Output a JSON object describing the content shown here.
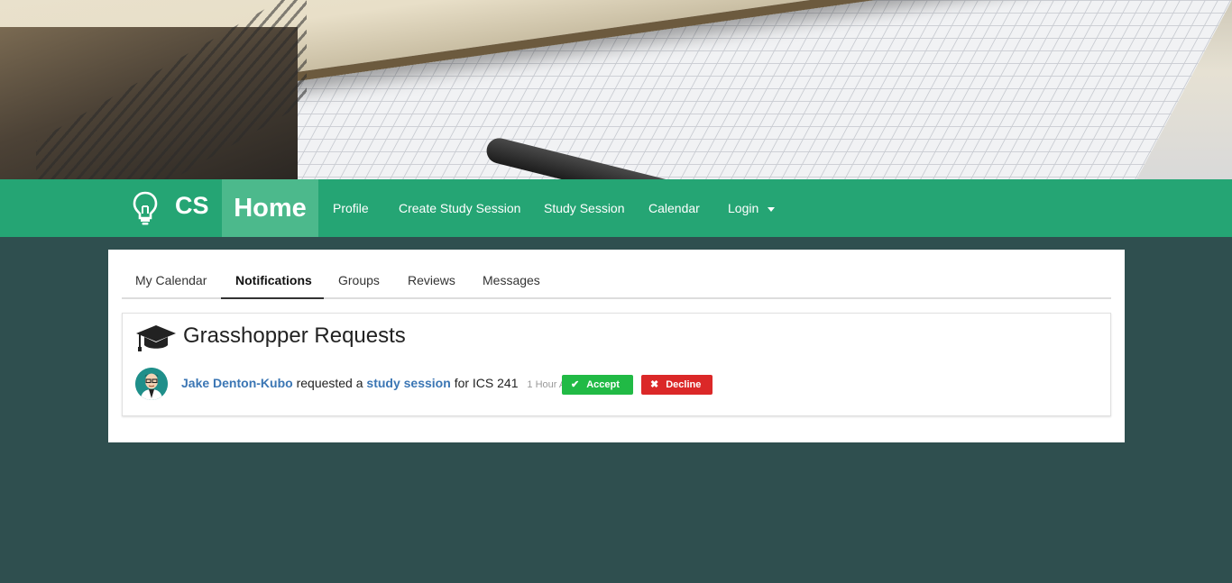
{
  "brand": {
    "text": "CS",
    "icon": "lightbulb-icon"
  },
  "nav": {
    "home": "Home",
    "items": [
      "Profile",
      "Create Study Session",
      "Study Session",
      "Calendar"
    ],
    "login": "Login"
  },
  "tabs": [
    "My Calendar",
    "Notifications",
    "Groups",
    "Reviews",
    "Messages"
  ],
  "active_tab": "Notifications",
  "card": {
    "icon": "graduation-cap-icon",
    "title": "Grasshopper Requests",
    "request": {
      "user": "Jake Denton-Kubo",
      "verb": "requested a",
      "object": "study session",
      "suffix": "for ICS 241",
      "time": "1 Hour Ago",
      "accept": "Accept",
      "decline": "Decline"
    }
  },
  "colors": {
    "navbar": "#25a574",
    "home_active": "#4cb98c",
    "background": "#2f4f4f",
    "accept": "#21ba45",
    "decline": "#db2828",
    "link": "#3b76b4"
  }
}
